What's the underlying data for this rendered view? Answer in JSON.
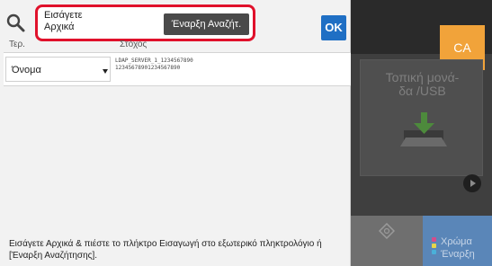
{
  "right_panel": {
    "ca_label": "CA",
    "usb_tile_label": "Τοπική μονά-\nδα /USB",
    "color_start_label_line1": "Χρώμα",
    "color_start_label_line2": "Έναρξη",
    "icons": [
      "download-icon",
      "stop-icon",
      "chevron-right-icon"
    ]
  },
  "search": {
    "input_value": "Εισάγετε\nΑρχικά",
    "start_button_label": "Έναρξη Αναζήτ.",
    "ok_label": "OK"
  },
  "columns": {
    "type_header": "Τερ.",
    "target_header": "Στόχος"
  },
  "row": {
    "type_value": "Όνομα",
    "target_line1": "LDAP_SERVER_1_1234567890",
    "target_line2": "12345678901234567890"
  },
  "instruction": "Εισάγετε Αρχικά & πιέστε το πλήκτρο Εισαγωγή στο εξωτερικό πληκτρολόγιο ή [Έναρξη Αναζήτησης].",
  "colors": {
    "highlight_frame": "#e0112b",
    "ok_button": "#1f6fc4",
    "ca_button": "#f1a33a",
    "color_start_tile": "#5a86b8"
  }
}
